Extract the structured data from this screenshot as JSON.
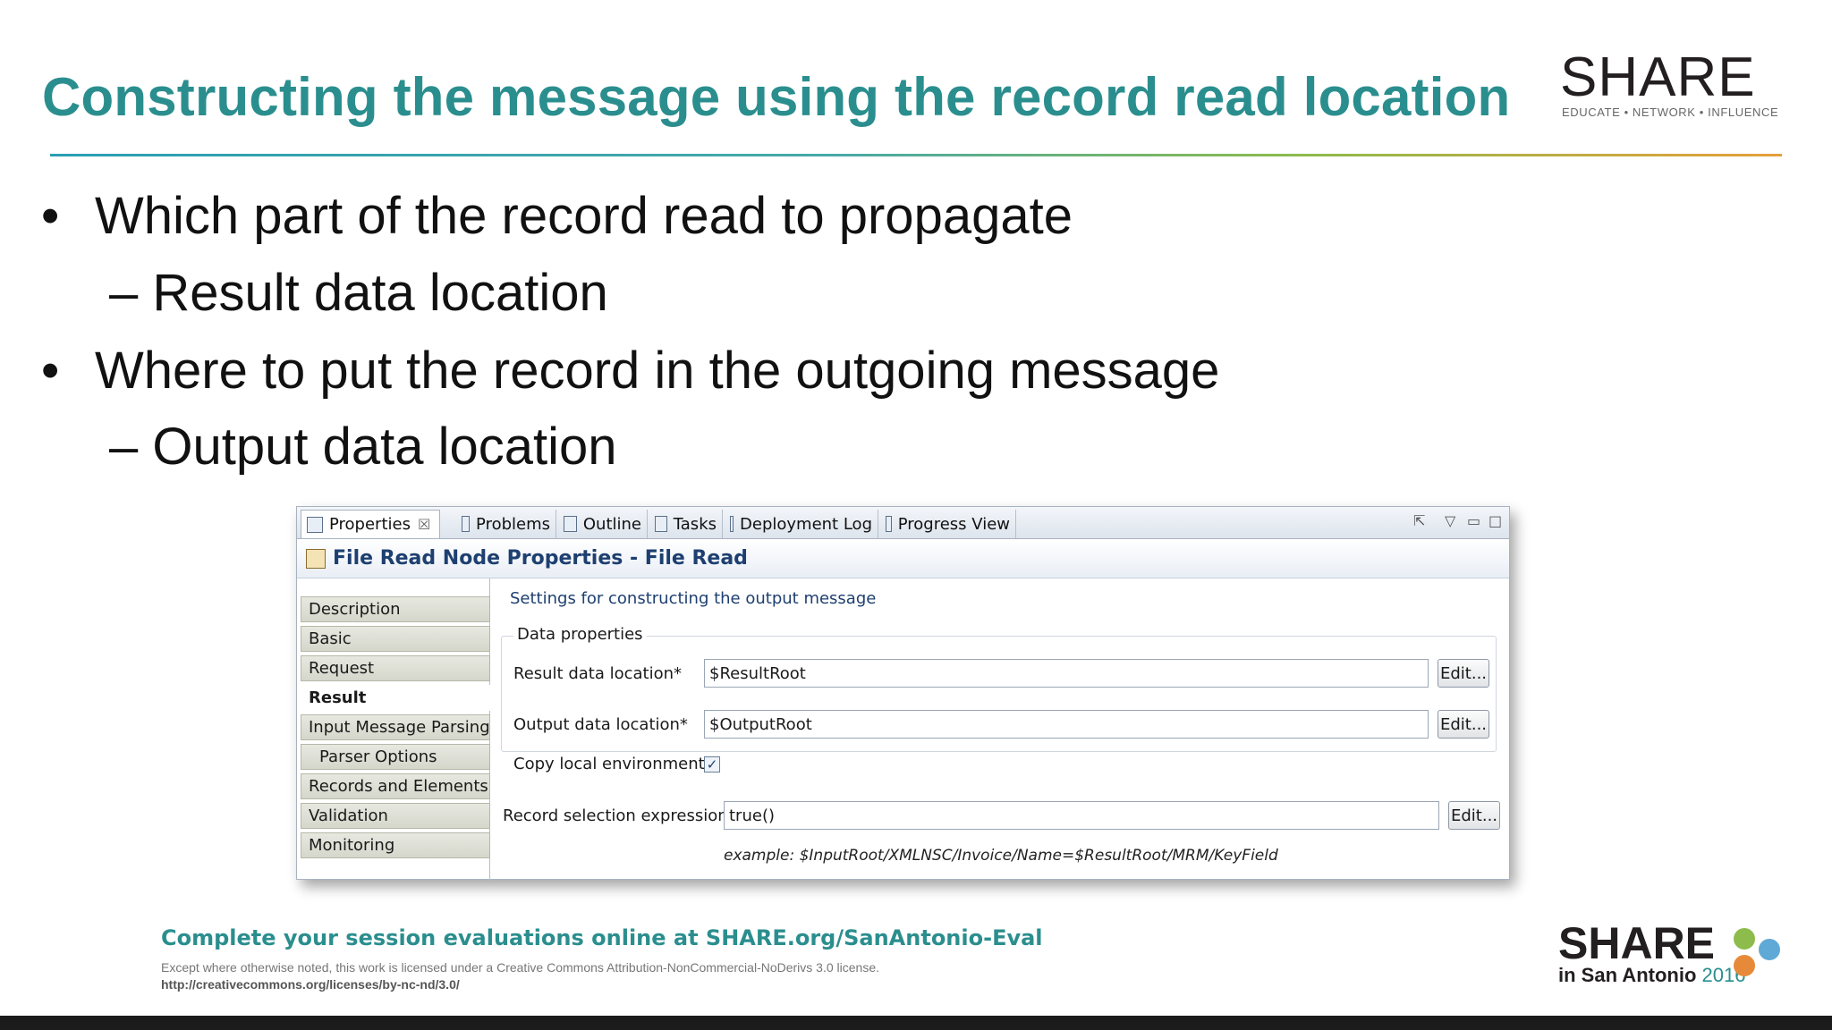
{
  "slide": {
    "title": "Constructing the message using the record read location",
    "bullets": [
      {
        "text": "Which part of the record read to propagate",
        "sub": "– Result data location"
      },
      {
        "text": "Where to put the record in the outgoing message",
        "sub": "– Output data location"
      }
    ],
    "bullet_glyph": "•"
  },
  "logo_top": {
    "name": "SHARE",
    "tagline": "EDUCATE • NETWORK • INFLUENCE"
  },
  "panel": {
    "tabs": [
      {
        "label": "Properties",
        "icon": "properties-icon",
        "active": true
      },
      {
        "label": "Problems",
        "icon": "problems-icon"
      },
      {
        "label": "Outline",
        "icon": "outline-icon"
      },
      {
        "label": "Tasks",
        "icon": "tasks-icon"
      },
      {
        "label": "Deployment Log",
        "icon": "deployment-log-icon"
      },
      {
        "label": "Progress View",
        "icon": "progress-view-icon"
      }
    ],
    "close_glyph": "☒",
    "header": "File Read Node Properties - File Read",
    "nav": [
      {
        "label": "Description"
      },
      {
        "label": "Basic"
      },
      {
        "label": "Request"
      },
      {
        "label": "Result",
        "selected": true
      },
      {
        "label": "Input Message Parsing"
      },
      {
        "label": "Parser Options",
        "sub": true
      },
      {
        "label": "Records and Elements"
      },
      {
        "label": "Validation"
      },
      {
        "label": "Monitoring"
      }
    ],
    "section_caption": "Settings for constructing the output message",
    "group_title": "Data properties",
    "result_label": "Result data location*",
    "result_value": "$ResultRoot",
    "output_label": "Output data location*",
    "output_value": "$OutputRoot",
    "copy_env_label": "Copy local environment",
    "copy_env_checked": true,
    "record_sel_label": "Record selection expression*",
    "record_sel_value": "true()",
    "edit_label": "Edit...",
    "example": "example: $InputRoot/XMLNSC/Invoice/Name=$ResultRoot/MRM/KeyField"
  },
  "footer": {
    "eval": "Complete your session evaluations online at SHARE.org/SanAntonio-Eval",
    "license": "Except where otherwise noted, this work is licensed under a Creative Commons Attribution-NonCommercial-NoDerivs 3.0 license.",
    "license_url": "http://creativecommons.org/licenses/by-nc-nd/3.0/",
    "logo_name": "SHARE",
    "logo_city": "in San Antonio",
    "logo_year": "2016"
  },
  "colors": {
    "title": "#2b8e8e",
    "header_text": "#1e3f70"
  }
}
